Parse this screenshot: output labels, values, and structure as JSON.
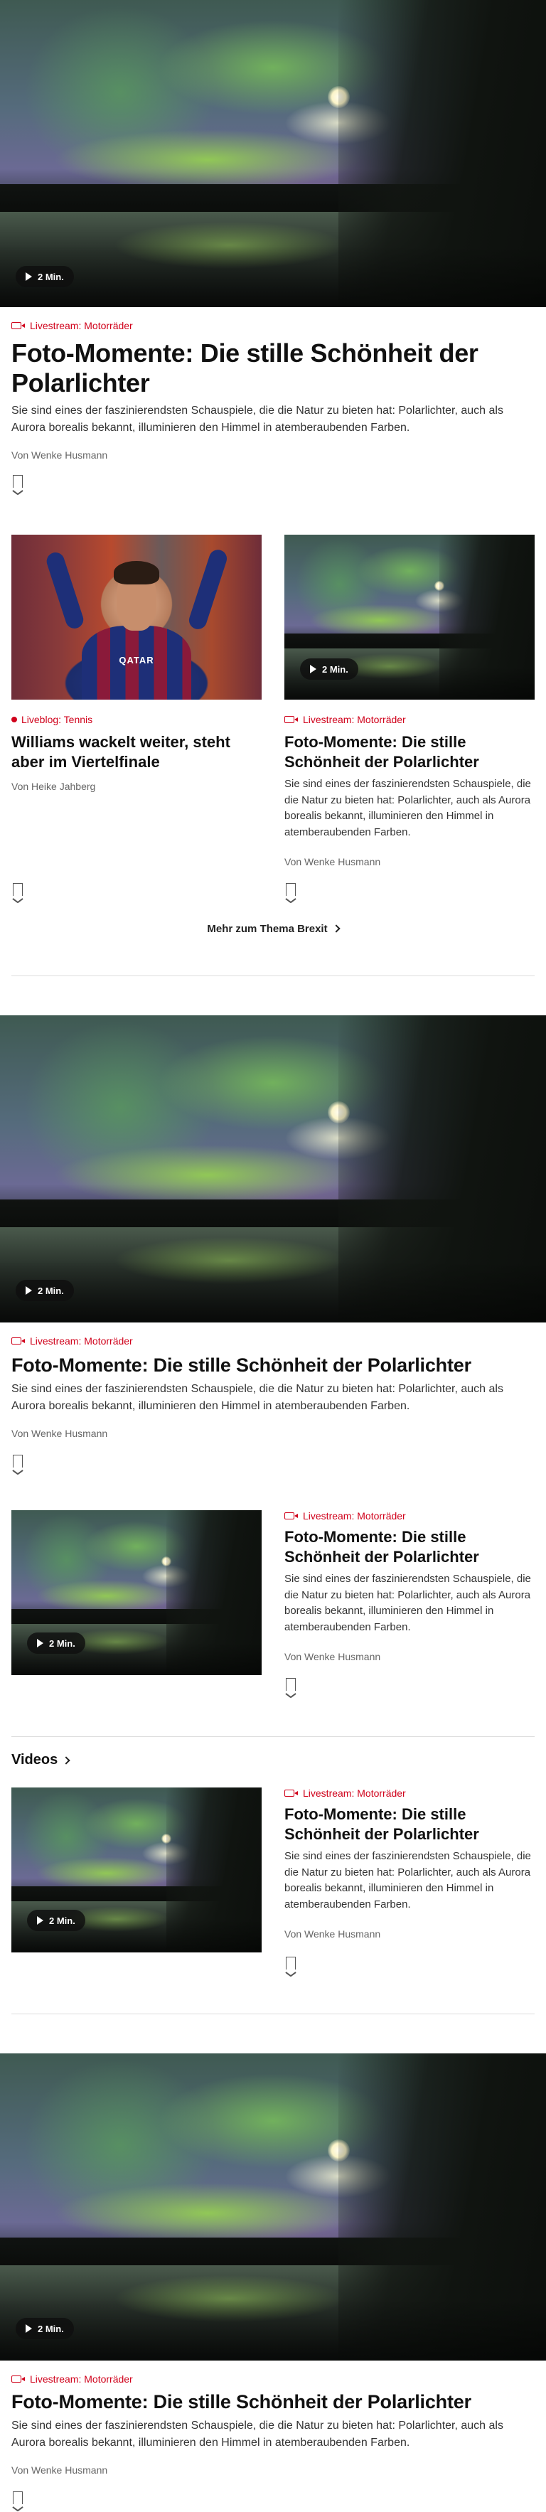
{
  "video_duration": "2 Min.",
  "hero1": {
    "kicker": "Livestream: Motorräder",
    "title": "Foto-Momente: Die stille Schönheit der Polarlichter",
    "teaser": "Sie sind eines der faszinierendsten Schauspiele, die die Natur zu bieten hat: Polarlichter, auch als Aurora borealis bekannt, illuminieren den Himmel in atemberaubenden Farben.",
    "author": "Von Wenke Husmann"
  },
  "grid": {
    "left": {
      "kicker": "Liveblog: Tennis",
      "title": "Williams wackelt weiter, steht aber im Viertelfinale",
      "author": "Von Heike Jahberg",
      "image_text": "QATAR"
    },
    "right": {
      "kicker": "Livestream: Motorräder",
      "title": "Foto-Momente: Die stille Schönheit der Polarlichter",
      "teaser": "Sie sind eines der faszinierendsten Schauspiele, die die Natur zu bieten hat: Polarlichter, auch als Aurora borealis bekannt, illuminieren den Himmel in atemberaubenden Farben.",
      "author": "Von Wenke Husmann"
    }
  },
  "more_link": "Mehr zum Thema Brexit",
  "hero2": {
    "kicker": "Livestream: Motorräder",
    "title": "Foto-Momente: Die stille Schönheit der Polarlichter",
    "teaser": "Sie sind eines der faszinierendsten Schauspiele, die die Natur zu bieten hat: Polarlichter, auch als Aurora borealis bekannt, illuminieren den Himmel in atemberaubenden Farben.",
    "author": "Von Wenke Husmann"
  },
  "side1": {
    "kicker": "Livestream: Motorräder",
    "title": "Foto-Momente: Die stille Schönheit der Polarlichter",
    "teaser": "Sie sind eines der faszinierendsten Schauspiele, die die Natur zu bieten hat: Polarlichter, auch als Aurora borealis bekannt, illuminieren den Himmel in atemberaubenden Farben.",
    "author": "Von Wenke Husmann"
  },
  "videos_heading": "Videos",
  "side2": {
    "kicker": "Livestream: Motorräder",
    "title": "Foto-Momente: Die stille Schönheit der Polarlichter",
    "teaser": "Sie sind eines der faszinierendsten Schauspiele, die die Natur zu bieten hat: Polarlichter, auch als Aurora borealis bekannt, illuminieren den Himmel in atemberaubenden Farben.",
    "author": "Von Wenke Husmann"
  },
  "hero3": {
    "kicker": "Livestream: Motorräder",
    "title": "Foto-Momente: Die stille Schönheit der Polarlichter",
    "teaser": "Sie sind eines der faszinierendsten Schauspiele, die die Natur zu bieten hat: Polarlichter, auch als Aurora borealis bekannt, illuminieren den Himmel in atemberaubenden Farben.",
    "author": "Von Wenke Husmann"
  },
  "colors": {
    "accent_red": "#d0021b",
    "text": "#111111",
    "muted": "#666666",
    "divider": "#dcdcdc"
  }
}
